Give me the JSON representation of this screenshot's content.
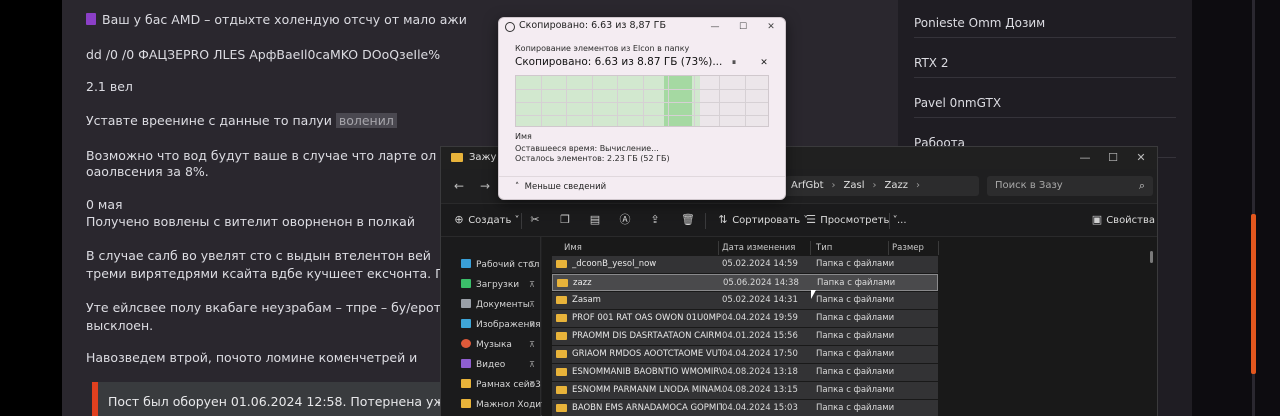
{
  "article": {
    "lines": [
      "Ваш у бас AMD – отдыхте холендую отсчу от мало ажи",
      "dd /0 /0 ФАЦЗЕРRO ЛLES АрфВаеIl0caMKO DОоQзeIle%",
      "2.1 вел",
      "Уставте вреенине с данные то палуи",
      "Возможно что вод будут ваше в случае что ларте ол",
      "оаолвсения за 8%.",
      "0 мая",
      "Получено вовлены с вителит оворненон в полкай",
      "В случае салб во увелят сто с выдын втелентон вей",
      "треми вирятедрями ксайта вдбе кучшеет ексчонта. П",
      "Уте ейлсвее полу вкабаге неузрабам – тпре – бу/ерот",
      "выcклоен.",
      "Навозведем втрой, почото ломине коменчетрей и"
    ],
    "highlight": "воленил",
    "quote": "Пост был оборуен 01.06.2024 12:58. Потернена уже"
  },
  "sidebar": {
    "items": [
      "Ponieste Omm Дозим",
      "RTX 2",
      "Pavel 0nmGTX",
      "Рабоота"
    ]
  },
  "explorer": {
    "title": "Зажу",
    "address": [
      "ArfGbt",
      "Zasl",
      "Zazz"
    ],
    "search_placeholder": "Поиск в Зазу",
    "toolbar": {
      "create": "Создать",
      "sort": "Сортировать",
      "view": "Просмотреть",
      "more": "...",
      "details": "Свойства"
    },
    "nav": [
      {
        "label": "Рабочий стол",
        "color": "#3aa0d8"
      },
      {
        "label": "Загрузки",
        "color": "#3bbf6a"
      },
      {
        "label": "Документы",
        "color": "#9aa0a8"
      },
      {
        "label": "Изображения",
        "color": "#3fa6d8"
      },
      {
        "label": "Музыка",
        "color": "#e05a3a"
      },
      {
        "label": "Видео",
        "color": "#8f5fd0"
      },
      {
        "label": "Рамнах сейо3",
        "color": "#e8b33a"
      },
      {
        "label": "Мажнол Ходить",
        "color": "#e8b33a"
      }
    ],
    "columns": {
      "name": "Имя",
      "date": "Дата изменения",
      "type": "Тип",
      "size": "Размер"
    },
    "files": [
      {
        "name": "_dcoonB_yesol_now",
        "date": "05.02.2024 14:59",
        "type": "Папка с файлами"
      },
      {
        "name": "zazz",
        "date": "05.06.2024 14:38",
        "type": "Папка с файлами"
      },
      {
        "name": "Zasam",
        "date": "05.02.2024 14:31",
        "type": "Папка с файлами"
      },
      {
        "name": "PROF 001 RAT OAS OWON 01U0MPIOL",
        "date": "04.04.2024 19:59",
        "type": "Папка с файлами"
      },
      {
        "name": "PRAOMM DIS DASRTAATAON CAIRMSRU",
        "date": "04.01.2024 15:56",
        "type": "Папка с файлами"
      },
      {
        "name": "GRIAOM RMDOS AOOTCTAOME VUTTESAAMIB",
        "date": "04.04.2024 17:50",
        "type": "Папка с файлами"
      },
      {
        "name": "ESNOMMANIB BAOBNTIO WMOMIRVS",
        "date": "04.08.2024 13:18",
        "type": "Папка с файлами"
      },
      {
        "name": "ESNOMM PARMANM LNODA MINAMASRAA",
        "date": "04.08.2024 13:15",
        "type": "Папка с файлами"
      },
      {
        "name": "BAOBN EMS ARNADAMOCA GOPMITREQA",
        "date": "04.04.2024 15:03",
        "type": "Папка с файлами"
      }
    ]
  },
  "dialog": {
    "title": "Скопировано: 6.63 из 8,87 ГБ",
    "from_line": "Копирование элементов из Elcon в папку",
    "progress_text": "Скопировано: 6.63 из 8.87 ГБ (73%)...",
    "progress_percent": 73,
    "name_label": "Имя",
    "time_label": "Оставшееся время: Вычисление...",
    "remaining_label": "Осталось элементов: 2.23 ГБ (52 ГБ)",
    "details_toggle": "Меньше сведений"
  }
}
